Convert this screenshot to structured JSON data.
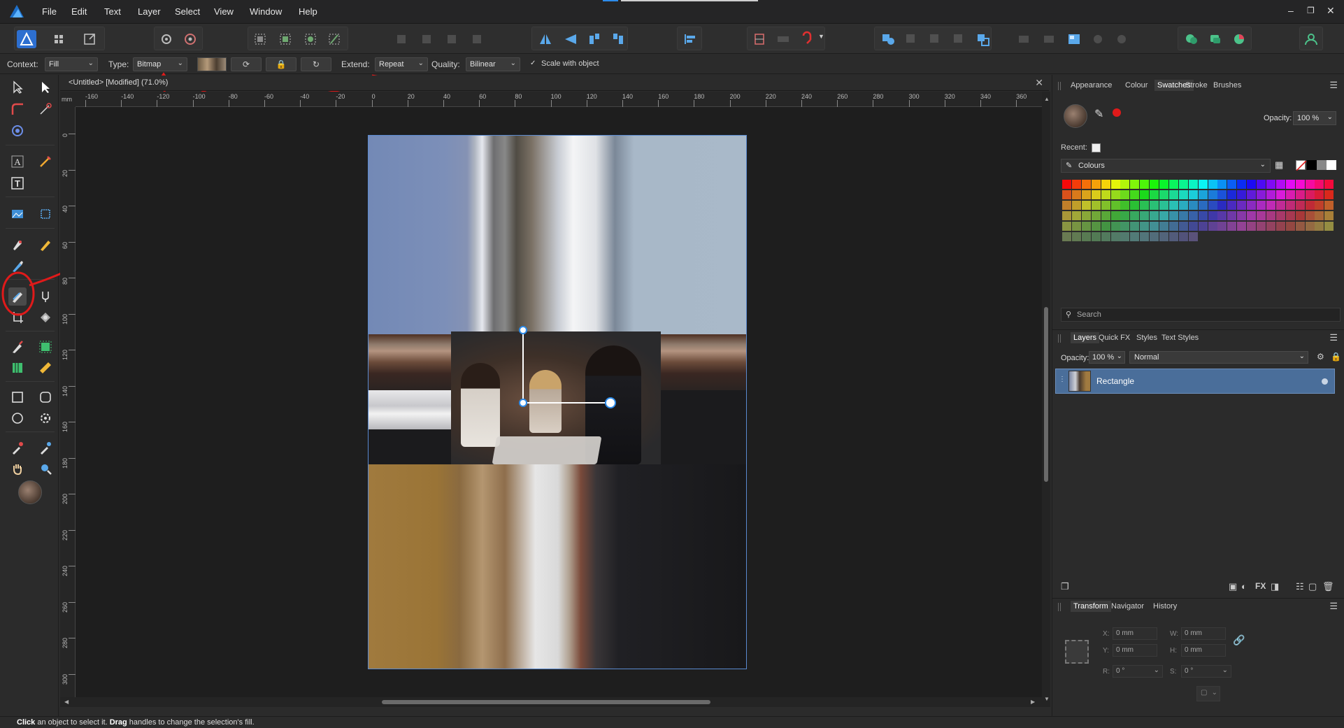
{
  "menu": [
    "File",
    "Edit",
    "Text",
    "Layer",
    "Select",
    "View",
    "Window",
    "Help"
  ],
  "context_bar": {
    "context_label": "Context:",
    "context_value": "Fill",
    "type_label": "Type:",
    "type_value": "Bitmap",
    "extend_label": "Extend:",
    "extend_value": "Repeat",
    "quality_label": "Quality:",
    "quality_value": "Bilinear",
    "scale_label": "Scale with object",
    "scale_checked": true
  },
  "document": {
    "tab_title": "<Untitled> [Modified] (71.0%)",
    "ruler_unit": "mm",
    "h_ticks": [
      "-160",
      "-140",
      "-120",
      "-100",
      "-80",
      "-60",
      "-40",
      "-20",
      "0",
      "20",
      "40",
      "60",
      "80",
      "100",
      "120",
      "140",
      "160",
      "180",
      "200",
      "220",
      "240",
      "260",
      "280",
      "300",
      "320",
      "340",
      "360"
    ],
    "v_ticks": [
      "0",
      "20",
      "40",
      "60",
      "80",
      "100",
      "120",
      "140",
      "160",
      "180",
      "200",
      "220",
      "240",
      "260",
      "280",
      "300"
    ]
  },
  "right_panel": {
    "top_tabs": [
      "Appearance",
      "Colour",
      "Swatches",
      "Stroke",
      "Brushes"
    ],
    "top_active": "Swatches",
    "opacity_label": "Opacity:",
    "opacity_value": "100 %",
    "recent_label": "Recent:",
    "palette_name": "Colours",
    "search_placeholder": "Search",
    "layers_tabs": [
      "Layers",
      "Quick FX",
      "Styles",
      "Text Styles"
    ],
    "layers_active": "Layers",
    "layers_opacity_label": "Opacity:",
    "layers_opacity_value": "100 %",
    "blend_mode": "Normal",
    "layer_name": "Rectangle",
    "transform_tabs": [
      "Transform",
      "Navigator",
      "History"
    ],
    "transform_active": "Transform",
    "transform": {
      "x_label": "X:",
      "x": "0 mm",
      "y_label": "Y:",
      "y": "0 mm",
      "w_label": "W:",
      "w": "0 mm",
      "h_label": "H:",
      "h": "0 mm",
      "r_label": "R:",
      "r": "0 °",
      "s_label": "S:",
      "s": "0 °"
    }
  },
  "status": {
    "click": "Click",
    "text1": " an object to select it. ",
    "drag": "Drag",
    "text2": " handles to change the selection's fill."
  },
  "colors": {
    "accent": "#2d8ceb",
    "selection_blue": "#4a6e9a",
    "annotation_red": "#e01a1a"
  }
}
